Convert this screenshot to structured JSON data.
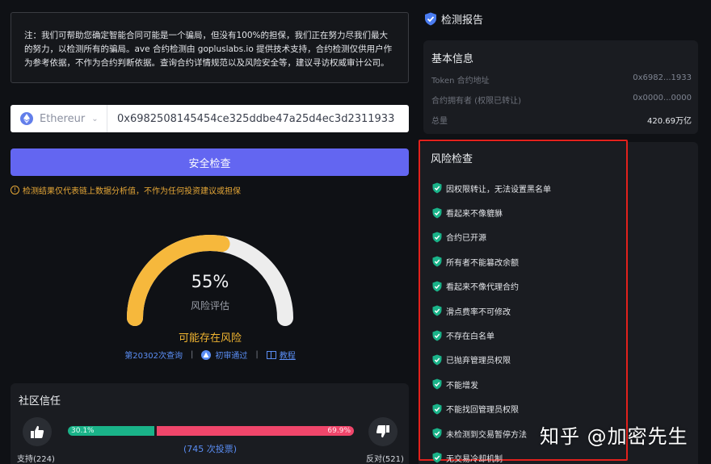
{
  "notice": {
    "text": "注：我们可帮助您确定智能合同可能是一个骗局，但没有100%的担保，我们正在努力尽我们最大的努力，以检测所有的骗局。ave 合约检测由 gopluslabs.io 提供技术支持，合约检测仅供用户作为参考依据，不作为合约判断依据。查询合约详情规范以及风险安全等，建议寻访权威审计公司。"
  },
  "search": {
    "chain": "Ethereur",
    "address": "0x6982508145454ce325ddbe47a25d4ec3d2311933",
    "button_label": "安全检查"
  },
  "disclaimer": "检测结果仅代表链上数据分析值，不作为任何投资建议或担保",
  "gauge": {
    "percent_text": "55%",
    "value": 0.55,
    "label": "风险评估",
    "risk_level": "可能存在风险",
    "query_count": "第20302次查询",
    "audit": "初审通过",
    "tutorial": "教程"
  },
  "community": {
    "title": "社区信任",
    "yes_pct_text": "30.1%",
    "no_pct_text": "69.9%",
    "yes_fraction": 0.301,
    "votes": "(745 次投票)",
    "support": "支持(224)",
    "oppose": "反对(521)"
  },
  "report": {
    "title": "检测报告",
    "basic": {
      "title": "基本信息",
      "rows": [
        {
          "key": "Token 合约地址",
          "value": "0x6982...1933"
        },
        {
          "key": "合约拥有者 (权限已转让)",
          "value": "0x0000...0000"
        },
        {
          "key": "总量",
          "value": "420.69万亿"
        }
      ]
    },
    "risk": {
      "title": "风险检查",
      "items": [
        "因权限转让，无法设置黑名单",
        "看起来不像貔貅",
        "合约已开源",
        "所有者不能篡改余额",
        "看起来不像代理合约",
        "滑点费率不可修改",
        "不存在白名单",
        "已抛弃管理员权限",
        "不能增发",
        "不能找回管理员权限",
        "未检测到交易暂停方法",
        "无交易冷却机制"
      ]
    }
  },
  "watermark": "知乎 @加密先生",
  "colors": {
    "accent": "#6366f1",
    "warning": "#f1b531",
    "safe": "#1ab389",
    "danger": "#f0466b",
    "link": "#5b8ef5",
    "highlight_frame": "#e2211c"
  }
}
